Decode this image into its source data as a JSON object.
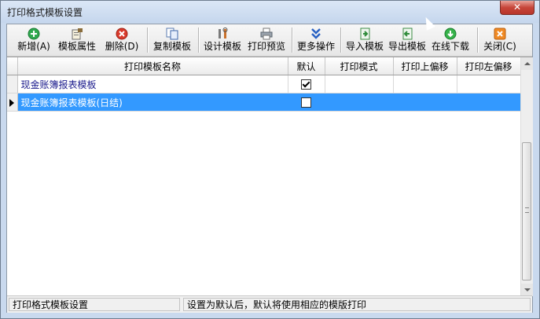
{
  "window": {
    "title": "打印格式模板设置",
    "close_label": "✕"
  },
  "toolbar": {
    "add_label": "新增(A)",
    "props_label": "模板属性",
    "delete_label": "删除(D)",
    "copy_label": "复制模板",
    "design_label": "设计模板",
    "preview_label": "打印预览",
    "more_label": "更多操作",
    "import_label": "导入模板",
    "export_label": "导出模板",
    "download_label": "在线下载",
    "close_label": "关闭(C)"
  },
  "table": {
    "headers": [
      "打印模板名称",
      "默认",
      "打印模式",
      "打印上偏移",
      "打印左偏移"
    ],
    "rows": [
      {
        "name": "现金账簿报表模板",
        "default": true,
        "mode": "",
        "top_offset": "",
        "left_offset": ""
      },
      {
        "name": "现金账簿报表模板(日结)",
        "default": false,
        "mode": "",
        "top_offset": "",
        "left_offset": ""
      }
    ]
  },
  "status": {
    "left": "打印格式模板设置",
    "right": "设置为默认后，默认将使用相应的模版打印"
  },
  "colors": {
    "selection": "#3399ff",
    "link_text": "#1a1a8c",
    "close_red": "#c7463a"
  }
}
